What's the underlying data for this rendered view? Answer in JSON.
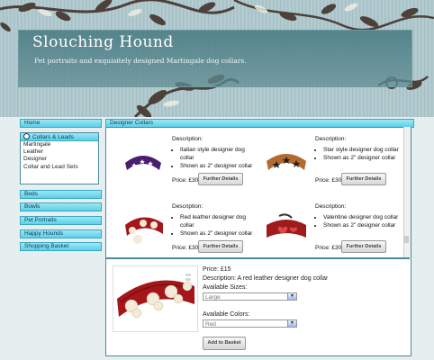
{
  "header": {
    "title": "Slouching Hound",
    "subtitle": "Pet portraits and exquisitely designed Martingale dog collars."
  },
  "sidebar": {
    "home": "Home",
    "category": "Collars & Leads",
    "subitems": [
      "Martingale",
      "Leather",
      "Designer",
      "Collar and Lead Sets"
    ],
    "links": [
      "Beds",
      "Bowls",
      "Pet Portraits",
      "Happy Hounds",
      "Shopping Basket"
    ]
  },
  "main": {
    "heading": "Designer Collars",
    "description_label": "Description:",
    "further_details": "Further Details",
    "products": [
      {
        "price": "Price: £30",
        "bullets": [
          "Italian style designer dog collar",
          "Shown as 2\" designer collar"
        ],
        "color": "#4a1e6e",
        "accent": "#ffffff"
      },
      {
        "price": "Price: £30",
        "bullets": [
          "Star style designer dog collar",
          "Shown as 2\" designer collar"
        ],
        "color": "#b36a2e",
        "accent": "#222222"
      },
      {
        "price": "Price: £30",
        "bullets": [
          "Red leather designer dog collar",
          "Shown as 2\" designer collar"
        ],
        "color": "#a4161a",
        "accent": "#f3ead7"
      },
      {
        "price": "Price: £30",
        "bullets": [
          "Valentine designer dog collar",
          "Shown as 2\" designer collar"
        ],
        "color": "#9e1b1e",
        "accent": "#e04848"
      }
    ]
  },
  "detail": {
    "price": "Price: £15",
    "description": "Description: A red leather designer dog collar",
    "sizes_label": "Available Sizes:",
    "size_value": "Large",
    "colors_label": "Available Colors:",
    "color_value": "Red",
    "add_to_basket": "Add to Basket"
  }
}
